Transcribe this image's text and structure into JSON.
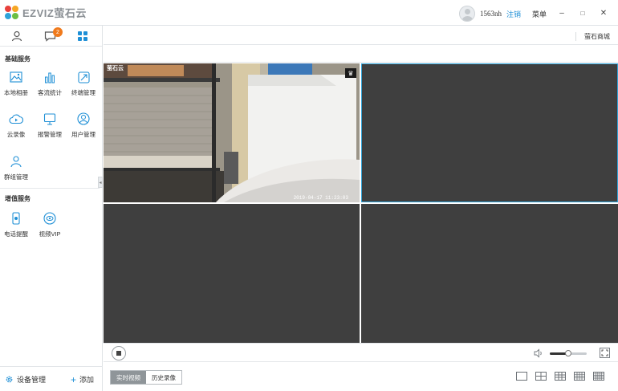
{
  "app": {
    "logo_text": "EZVIZ萤石云",
    "username": "1563nh",
    "logout_label": "注销",
    "menu_label": "菜单",
    "accent_color": "#1e8fd6"
  },
  "window_controls": {
    "minimize": "–",
    "maximize": "□",
    "close": "✕"
  },
  "sidebar": {
    "message_badge": "2",
    "basic_services_title": "基础服务",
    "basic_services": [
      {
        "label": "本地相册",
        "icon": "photo-album-icon"
      },
      {
        "label": "客流统计",
        "icon": "bar-chart-icon"
      },
      {
        "label": "终端管理",
        "icon": "device-manage-icon"
      },
      {
        "label": "云录像",
        "icon": "cloud-play-icon"
      },
      {
        "label": "报警管理",
        "icon": "monitor-icon"
      },
      {
        "label": "用户管理",
        "icon": "user-icon"
      },
      {
        "label": "群组管理",
        "icon": "group-icon"
      }
    ],
    "value_services_title": "增值服务",
    "value_services": [
      {
        "label": "电话提醒",
        "icon": "phone-alert-icon"
      },
      {
        "label": "视频VIP",
        "icon": "vip-eye-icon"
      }
    ],
    "device_manage_label": "设备管理",
    "add_label": "添加"
  },
  "main": {
    "store_link": "萤石商城",
    "video": {
      "timestamp": "2019-04-17 11:23:03",
      "watermark": "萤石云"
    },
    "volume_level": 0.5,
    "tabs": [
      {
        "label": "实时视频",
        "active": true
      },
      {
        "label": "历史录像",
        "active": false
      }
    ],
    "layout_options": [
      "1-screen",
      "4-screen",
      "9-screen",
      "16-screen",
      "25-screen"
    ]
  }
}
